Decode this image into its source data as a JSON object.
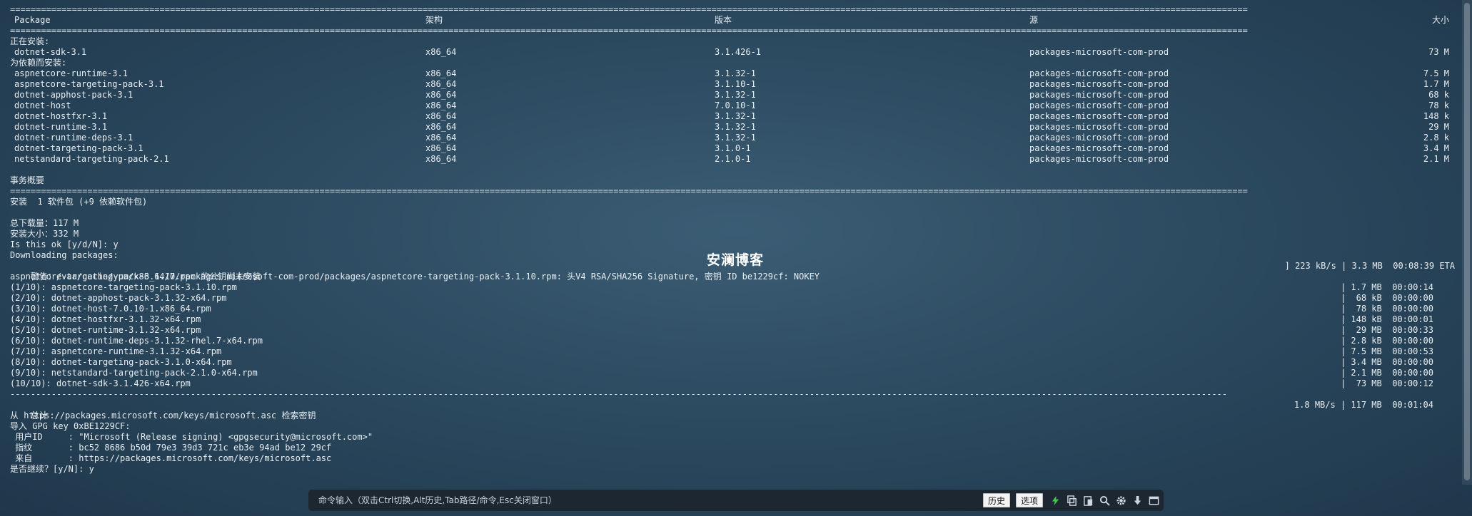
{
  "header": {
    "package": "Package",
    "arch": "架构",
    "version": "版本",
    "repo": "源",
    "size": "大小"
  },
  "installing_label": "正在安装:",
  "installing": [
    {
      "pkg": "dotnet-sdk-3.1",
      "arch": "x86_64",
      "ver": "3.1.426-1",
      "repo": "packages-microsoft-com-prod",
      "size": "73 M"
    }
  ],
  "deps_label": "为依赖而安装:",
  "deps": [
    {
      "pkg": "aspnetcore-runtime-3.1",
      "arch": "x86_64",
      "ver": "3.1.32-1",
      "repo": "packages-microsoft-com-prod",
      "size": "7.5 M"
    },
    {
      "pkg": "aspnetcore-targeting-pack-3.1",
      "arch": "x86_64",
      "ver": "3.1.10-1",
      "repo": "packages-microsoft-com-prod",
      "size": "1.7 M"
    },
    {
      "pkg": "dotnet-apphost-pack-3.1",
      "arch": "x86_64",
      "ver": "3.1.32-1",
      "repo": "packages-microsoft-com-prod",
      "size": "68 k"
    },
    {
      "pkg": "dotnet-host",
      "arch": "x86_64",
      "ver": "7.0.10-1",
      "repo": "packages-microsoft-com-prod",
      "size": "78 k"
    },
    {
      "pkg": "dotnet-hostfxr-3.1",
      "arch": "x86_64",
      "ver": "3.1.32-1",
      "repo": "packages-microsoft-com-prod",
      "size": "148 k"
    },
    {
      "pkg": "dotnet-runtime-3.1",
      "arch": "x86_64",
      "ver": "3.1.32-1",
      "repo": "packages-microsoft-com-prod",
      "size": "29 M"
    },
    {
      "pkg": "dotnet-runtime-deps-3.1",
      "arch": "x86_64",
      "ver": "3.1.32-1",
      "repo": "packages-microsoft-com-prod",
      "size": "2.8 k"
    },
    {
      "pkg": "dotnet-targeting-pack-3.1",
      "arch": "x86_64",
      "ver": "3.1.0-1",
      "repo": "packages-microsoft-com-prod",
      "size": "3.4 M"
    },
    {
      "pkg": "netstandard-targeting-pack-2.1",
      "arch": "x86_64",
      "ver": "2.1.0-1",
      "repo": "packages-microsoft-com-prod",
      "size": "2.1 M"
    }
  ],
  "summary_label": "事务概要",
  "install_summary": "安装  1 软件包 (+9 依赖软件包)",
  "total_download": "总下载量：117 M",
  "install_size": "安装大小：332 M",
  "confirm1": "Is this ok [y/d/N]: y",
  "downloading": "Downloading packages:",
  "warning_left": "警告：/var/cache/yum/x86_64/7/packages-microsoft-com-prod/packages/aspnetcore-targeting-pack-3.1.10.rpm: 头V4 RSA/SHA256 Signature, 密钥 ID be1229cf: NOKEY",
  "warning_right": "] 223 kB/s | 3.3 MB  00:08:39 ETA",
  "pubkey_missing": "aspnetcore-targeting-pack-3.1.10.rpm 的公钥尚未安装",
  "downloads": [
    {
      "name": "(1/10): aspnetcore-targeting-pack-3.1.10.rpm",
      "stat": "| 1.7 MB  00:00:14"
    },
    {
      "name": "(2/10): dotnet-apphost-pack-3.1.32-x64.rpm",
      "stat": "|  68 kB  00:00:00"
    },
    {
      "name": "(3/10): dotnet-host-7.0.10-1.x86_64.rpm",
      "stat": "|  78 kB  00:00:00"
    },
    {
      "name": "(4/10): dotnet-hostfxr-3.1.32-x64.rpm",
      "stat": "| 148 kB  00:00:01"
    },
    {
      "name": "(5/10): dotnet-runtime-3.1.32-x64.rpm",
      "stat": "|  29 MB  00:00:33"
    },
    {
      "name": "(6/10): dotnet-runtime-deps-3.1.32-rhel.7-x64.rpm",
      "stat": "| 2.8 kB  00:00:00"
    },
    {
      "name": "(7/10): aspnetcore-runtime-3.1.32-x64.rpm",
      "stat": "| 7.5 MB  00:00:53"
    },
    {
      "name": "(8/10): dotnet-targeting-pack-3.1.0-x64.rpm",
      "stat": "| 3.4 MB  00:00:00"
    },
    {
      "name": "(9/10): netstandard-targeting-pack-2.1.0-x64.rpm",
      "stat": "| 2.1 MB  00:00:00"
    },
    {
      "name": "(10/10): dotnet-sdk-3.1.426-x64.rpm",
      "stat": "|  73 MB  00:00:12"
    }
  ],
  "total_label": "总计",
  "total_stat": "1.8 MB/s | 117 MB  00:01:04",
  "key_fetch": "从 https://packages.microsoft.com/keys/microsoft.asc 检索密钥",
  "key_import": "导入 GPG key 0xBE1229CF:",
  "key_user": " 用户ID     : \"Microsoft (Release signing) <gpgsecurity@microsoft.com>\"",
  "key_fp": " 指纹       : bc52 8686 b50d 79e3 39d3 721c eb3e 94ad be12 29cf",
  "key_from": " 来自       : https://packages.microsoft.com/keys/microsoft.asc",
  "confirm2": "是否继续？[y/N]: y",
  "watermark": "安澜博客",
  "cmdbar": {
    "placeholder": "命令输入（双击Ctrl切换,Alt历史,Tab路径/命令,Esc关闭窗口）",
    "history": "历史",
    "options": "选项",
    "icons": [
      "lightning-icon",
      "copy-icon",
      "paste-icon",
      "search-icon",
      "gear-icon",
      "download-icon",
      "window-icon"
    ],
    "accent": "#3fc94b"
  }
}
